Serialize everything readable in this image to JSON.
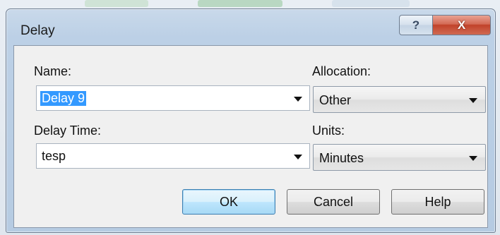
{
  "dialog": {
    "title": "Delay",
    "help_glyph": "?",
    "close_glyph": "X"
  },
  "fields": {
    "name_label": "Name:",
    "name_value": "Delay 9",
    "allocation_label": "Allocation:",
    "allocation_value": "Other",
    "delay_time_label": "Delay Time:",
    "delay_time_value": "tesp",
    "units_label": "Units:",
    "units_value": "Minutes"
  },
  "buttons": {
    "ok": "OK",
    "cancel": "Cancel",
    "help": "Help"
  }
}
